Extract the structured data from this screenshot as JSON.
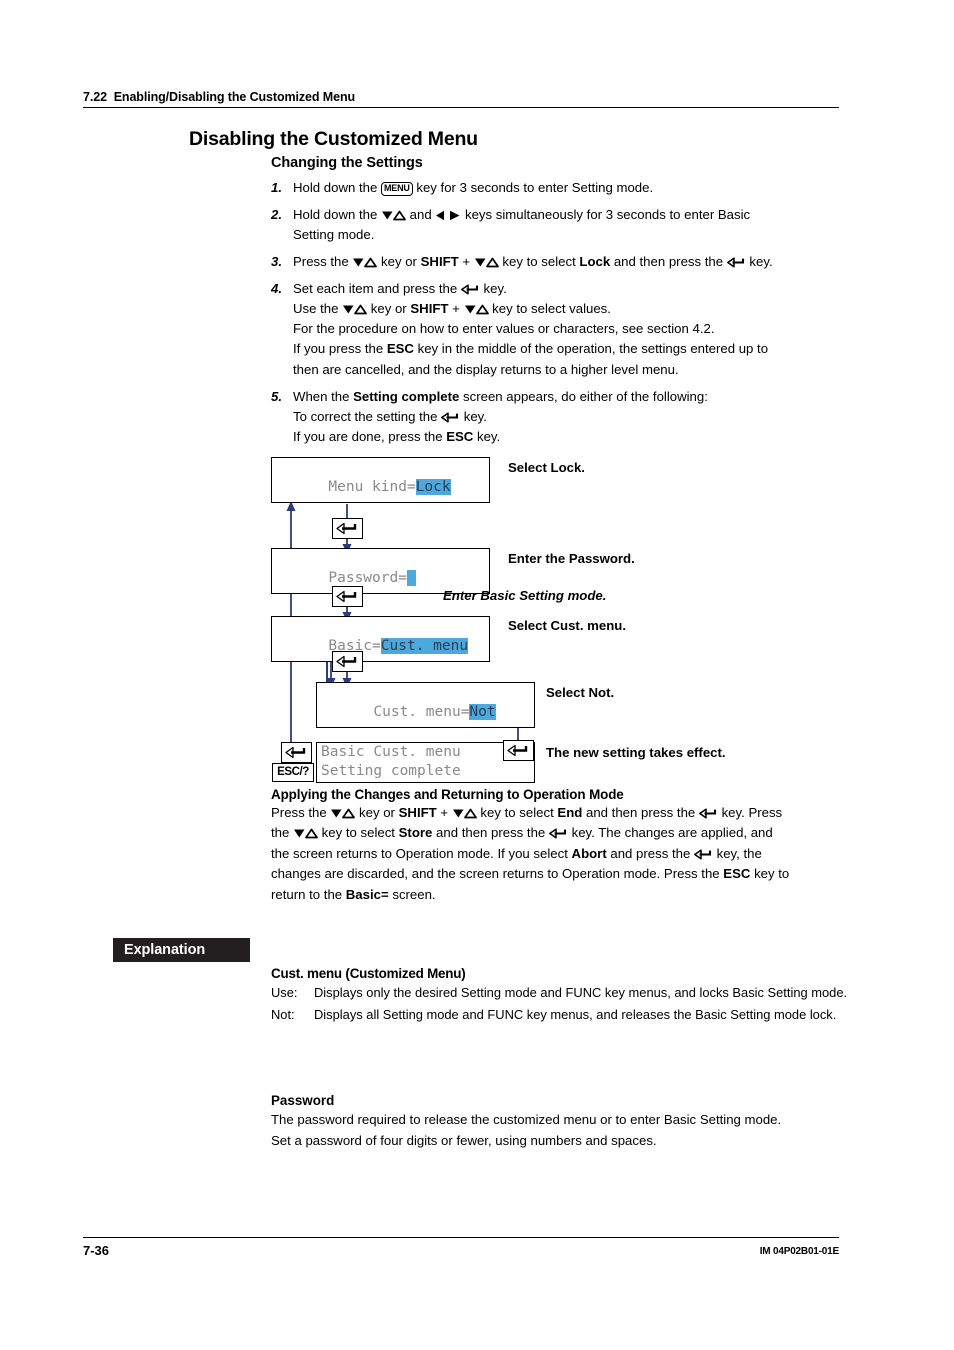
{
  "header": {
    "section_number": "7.22",
    "section_title": "Enabling/Disabling the Customized Menu"
  },
  "title": "Disabling the Customized Menu",
  "subtitle": "Changing the Settings",
  "steps": [
    {
      "num": "1.",
      "lines": [
        {
          "parts": [
            {
              "t": "Hold down the "
            },
            {
              "key": "MENU"
            },
            {
              "t": " key for 3 seconds to enter Setting mode."
            }
          ]
        }
      ]
    },
    {
      "num": "2.",
      "lines": [
        {
          "parts": [
            {
              "t": "Hold down the "
            },
            {
              "glyph": "updown-key-icon"
            },
            {
              "t": " and "
            },
            {
              "glyph": "leftright-key-icon"
            },
            {
              "t": " keys simultaneously for 3 seconds to enter Basic"
            }
          ]
        },
        {
          "parts": [
            {
              "t": "Setting mode."
            }
          ]
        }
      ]
    },
    {
      "num": "3.",
      "lines": [
        {
          "parts": [
            {
              "t": "Press the "
            },
            {
              "glyph": "updown-key-icon"
            },
            {
              "t": " key or "
            },
            {
              "b": "SHIFT"
            },
            {
              "t": " + "
            },
            {
              "glyph": "updown-key-icon"
            },
            {
              "t": " key to select "
            },
            {
              "b": "Lock"
            },
            {
              "t": " and then press the "
            },
            {
              "glyph": "enter-key-icon"
            },
            {
              "t": " key."
            }
          ]
        }
      ]
    },
    {
      "num": "4.",
      "lines": [
        {
          "parts": [
            {
              "t": "Set each item and press the "
            },
            {
              "glyph": "enter-key-icon"
            },
            {
              "t": " key."
            }
          ]
        },
        {
          "parts": [
            {
              "t": "Use the "
            },
            {
              "glyph": "updown-key-icon"
            },
            {
              "t": " key or "
            },
            {
              "b": "SHIFT"
            },
            {
              "t": " + "
            },
            {
              "glyph": "updown-key-icon"
            },
            {
              "t": " key to select values."
            }
          ]
        },
        {
          "parts": [
            {
              "t": "For the procedure on how to enter values or characters, see section 4.2."
            }
          ]
        },
        {
          "parts": [
            {
              "t": "If you press the "
            },
            {
              "b": "ESC"
            },
            {
              "t": " key in the middle of the operation, the settings entered up to"
            }
          ]
        },
        {
          "parts": [
            {
              "t": "then are cancelled, and the display returns to a higher level menu."
            }
          ]
        }
      ]
    },
    {
      "num": "5.",
      "lines": [
        {
          "parts": [
            {
              "t": "When the "
            },
            {
              "b": "Setting complete"
            },
            {
              "t": " screen appears, do either of the following:"
            }
          ]
        },
        {
          "parts": [
            {
              "t": "To correct the setting the "
            },
            {
              "glyph": "enter-key-icon"
            },
            {
              "t": " key."
            }
          ]
        },
        {
          "parts": [
            {
              "t": "If you are done, press the "
            },
            {
              "b": "ESC"
            },
            {
              "t": " key."
            }
          ]
        }
      ]
    }
  ],
  "diagram": {
    "screens": [
      {
        "name": "menu-kind",
        "line1_pre": "Menu kind=",
        "line1_hl": "Lock",
        "line2": ""
      },
      {
        "name": "password",
        "line1_pre": "Password=",
        "cursor": true,
        "line2": ""
      },
      {
        "name": "basic",
        "line1_pre": "Basic=",
        "line1_hl": "Cust. menu",
        "line2": ""
      },
      {
        "name": "cust-menu",
        "line1_pre": "Cust. menu=",
        "line1_hl": "Not",
        "line2": ""
      },
      {
        "name": "setting-complete",
        "line1_pre": "Basic Cust. menu",
        "line2": "Setting complete"
      }
    ],
    "notes": [
      {
        "text": "Select Lock.",
        "italic": false
      },
      {
        "text": "Enter the Password.",
        "italic": false
      },
      {
        "text": "Enter Basic Setting mode.",
        "italic": true
      },
      {
        "text": "Select Cust. menu.",
        "italic": false
      },
      {
        "text": "Select Not.",
        "italic": false
      },
      {
        "text": "The new setting takes effect.",
        "italic": false
      }
    ],
    "esc_key_label": "ESC/?",
    "wire_color": "#2b3c7a"
  },
  "applying": {
    "heading": "Applying the Changes and Returning to Operation Mode",
    "lines": [
      {
        "parts": [
          {
            "t": "Press the "
          },
          {
            "glyph": "updown-key-icon"
          },
          {
            "t": " key or "
          },
          {
            "b": "SHIFT"
          },
          {
            "t": " + "
          },
          {
            "glyph": "updown-key-icon"
          },
          {
            "t": " key to select "
          },
          {
            "b": "End"
          },
          {
            "t": " and then press the "
          },
          {
            "glyph": "enter-key-icon"
          },
          {
            "t": " key. Press"
          }
        ]
      },
      {
        "parts": [
          {
            "t": "the "
          },
          {
            "glyph": "updown-key-icon"
          },
          {
            "t": " key to select "
          },
          {
            "b": "Store"
          },
          {
            "t": " and then press the "
          },
          {
            "glyph": "enter-key-icon"
          },
          {
            "t": " key. The changes are applied, and"
          }
        ]
      },
      {
        "parts": [
          {
            "t": "the screen returns to Operation mode. If you select "
          },
          {
            "b": "Abort"
          },
          {
            "t": " and press the "
          },
          {
            "glyph": "enter-key-icon"
          },
          {
            "t": " key, the"
          }
        ]
      },
      {
        "parts": [
          {
            "t": "changes are discarded, and the screen returns to Operation mode. Press the "
          },
          {
            "b": "ESC"
          },
          {
            "t": " key to"
          }
        ]
      },
      {
        "parts": [
          {
            "t": "return to the "
          },
          {
            "b": "Basic="
          },
          {
            "t": " screen."
          }
        ]
      }
    ]
  },
  "explanation": {
    "tag": "Explanation",
    "title": "Cust. menu (Customized Menu)",
    "definitions": [
      {
        "term": "Use:",
        "desc": "Displays only the desired Setting mode and FUNC key menus, and locks Basic Setting mode."
      },
      {
        "term": "Not:",
        "desc": "Displays all Setting mode and FUNC key menus, and releases the Basic Setting mode lock."
      }
    ]
  },
  "password_section": {
    "title": "Password",
    "lines": [
      "The password required to release the customized menu or to enter Basic Setting mode.",
      "Set a password of four digits or fewer, using numbers and spaces."
    ]
  },
  "footer": {
    "page_number": "7-36",
    "doc_code": "IM 04P02B01-01E"
  }
}
